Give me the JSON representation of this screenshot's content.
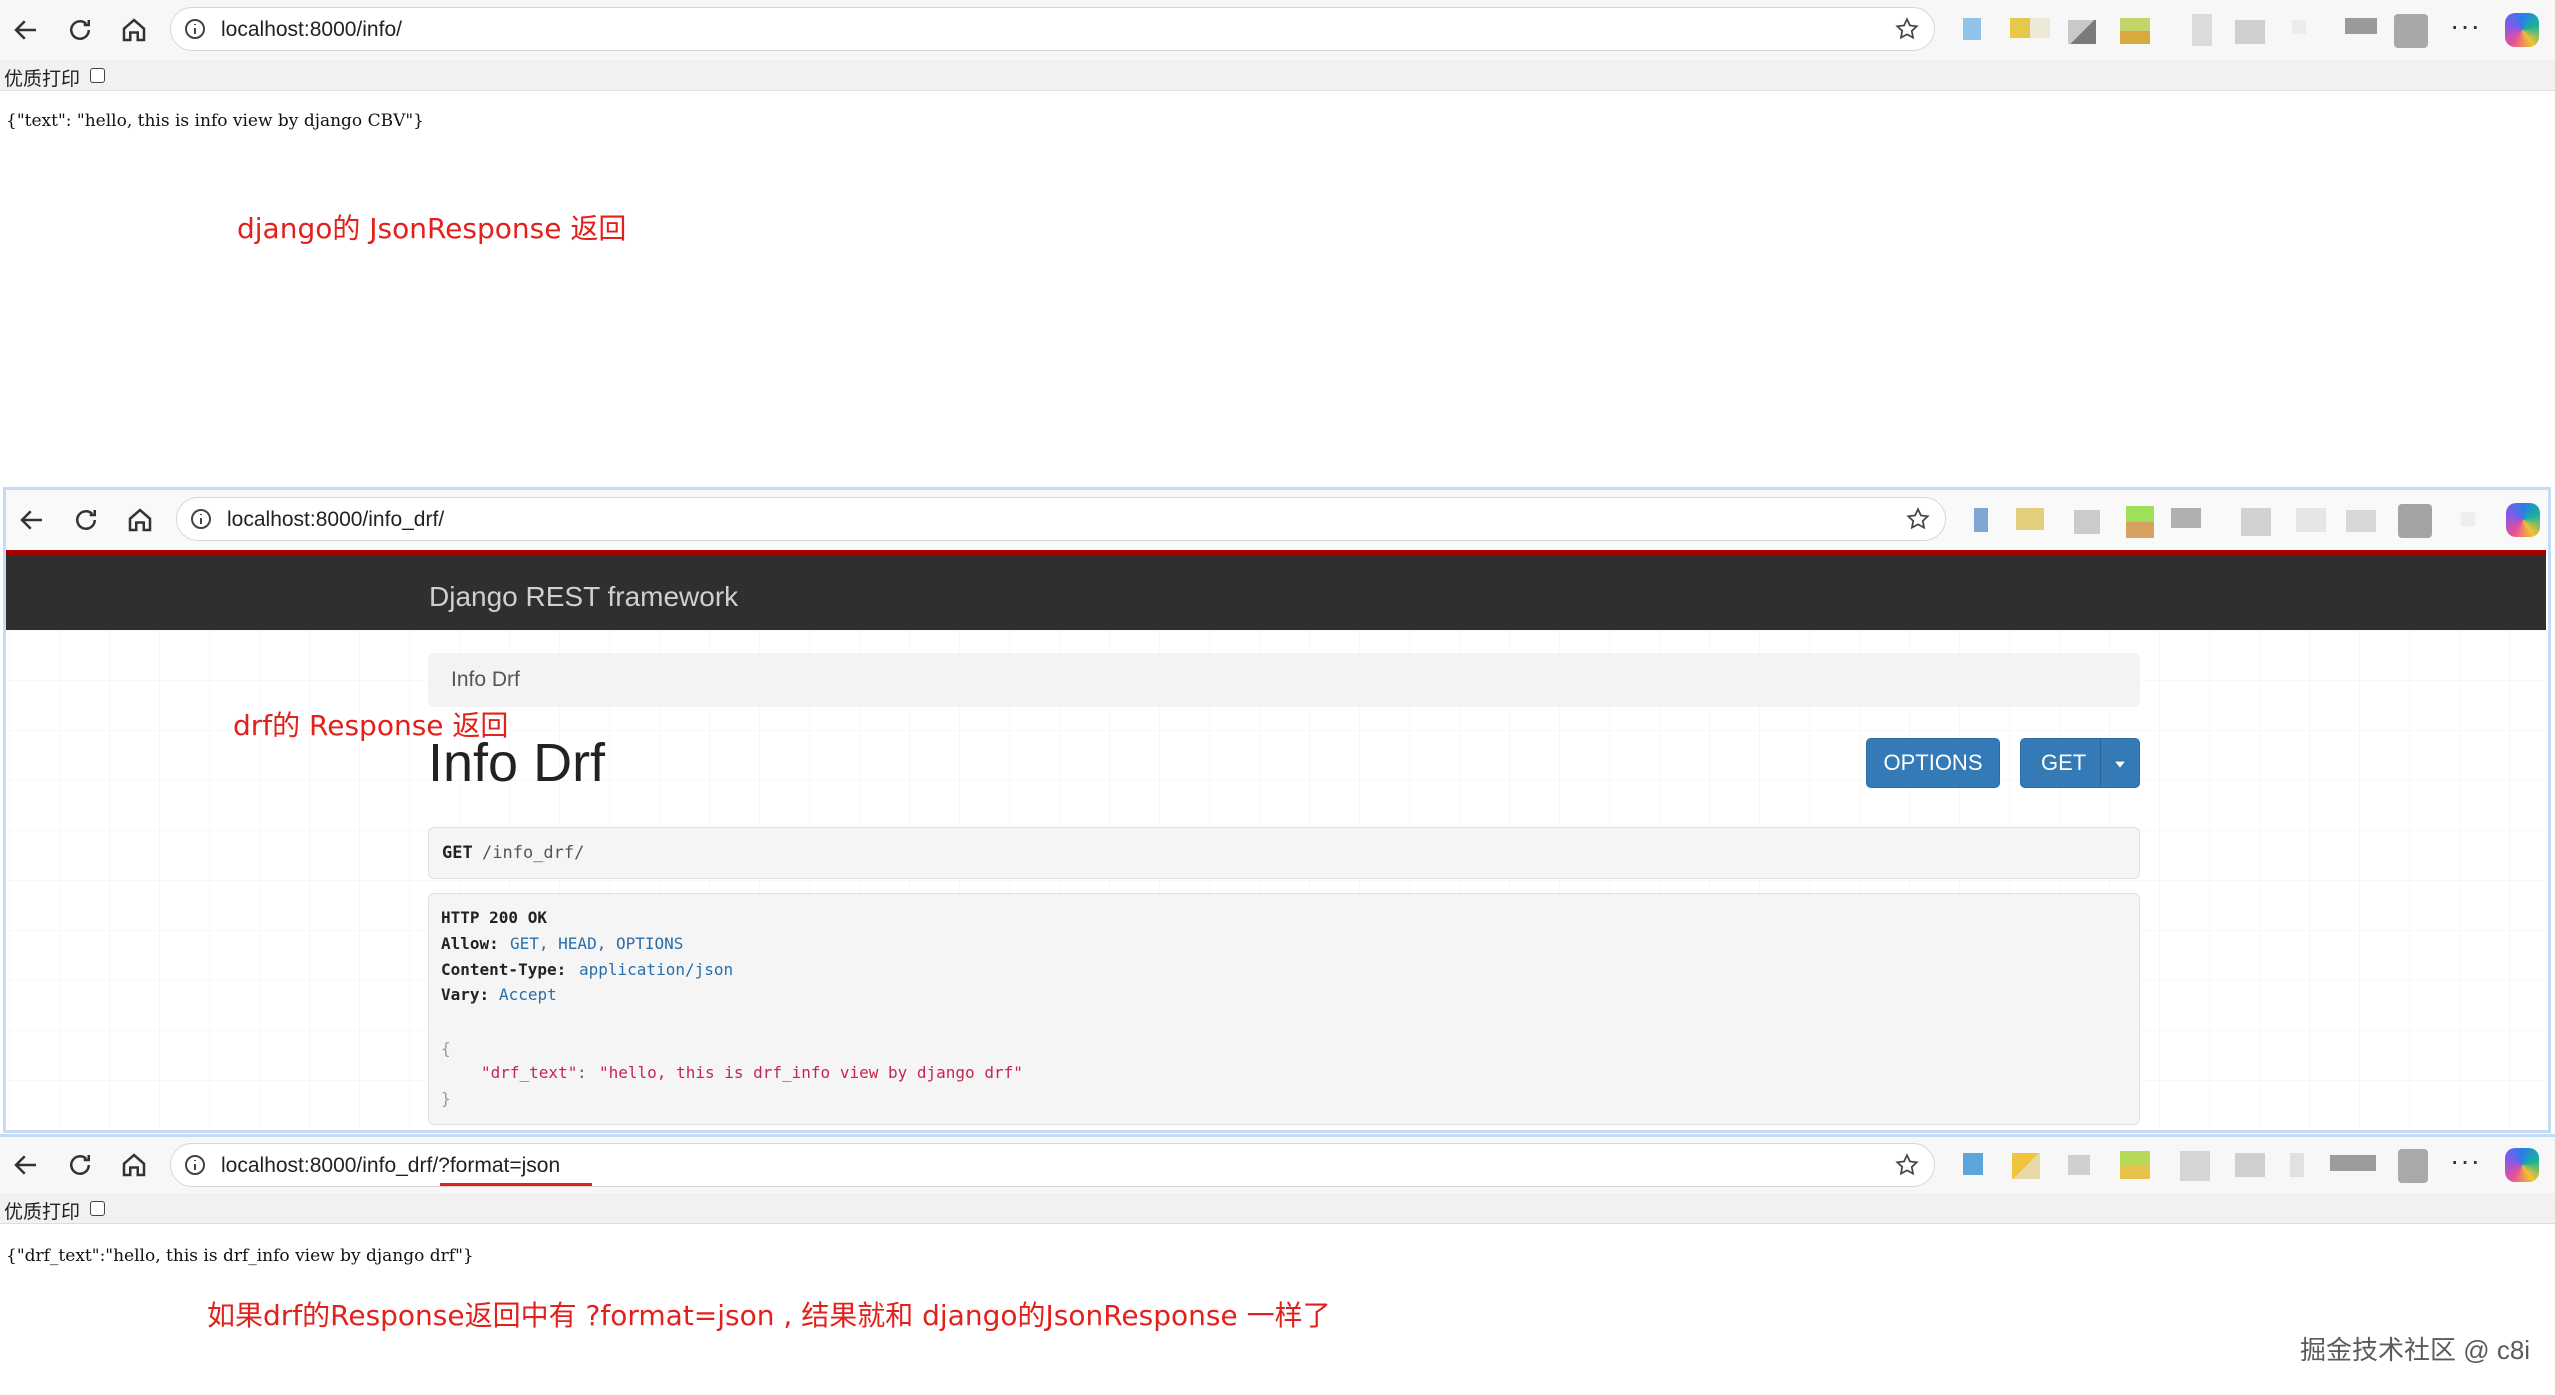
{
  "window1": {
    "url": "localhost:8000/info/",
    "print_label": "优质打印",
    "body_text": "{\"text\": \"hello, this is info view by django CBV\"}",
    "note": "django的 JsonResponse 返回"
  },
  "window2": {
    "url": "localhost:8000/info_drf/",
    "brand": "Django REST framework",
    "breadcrumb": "Info Drf",
    "note": "drf的 Response 返回",
    "page_title": "Info Drf",
    "options_label": "OPTIONS",
    "get_label": "GET",
    "request": {
      "method": "GET",
      "path": "/info_drf/"
    },
    "response": {
      "status": "HTTP 200 OK",
      "allow_key": "Allow:",
      "allow_val": "GET, HEAD, OPTIONS",
      "ctype_key": "Content-Type:",
      "ctype_val": "application/json",
      "vary_key": "Vary:",
      "vary_val": "Accept",
      "open": "{",
      "json_key": "\"drf_text\"",
      "json_sep": ": ",
      "json_val": "\"hello, this is drf_info view by django drf\"",
      "close": "}"
    }
  },
  "window3": {
    "url": "localhost:8000/info_drf/?format=json",
    "print_label": "优质打印",
    "body_text": "{\"drf_text\":\"hello, this is drf_info view by django drf\"}",
    "note": "如果drf的Response返回中有 ?format=json , 结果就和 django的JsonResponse 一样了"
  },
  "watermark": "掘金技术社区 @ c8i",
  "menu_label": "···",
  "colors": {
    "annotation": "#e3211c",
    "drf_header": "#2f2f2f",
    "drf_accent": "#a30000",
    "button": "#337ab7"
  }
}
